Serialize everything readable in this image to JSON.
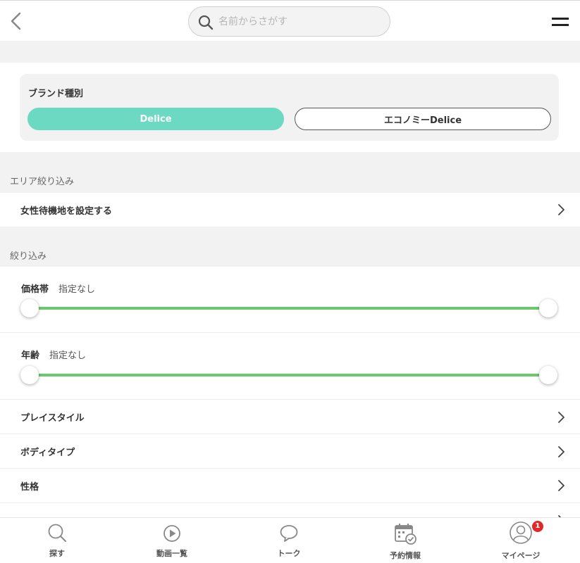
{
  "header": {
    "back_icon": "chevron-left-icon",
    "search_placeholder": "名前からさがす",
    "search_icon": "search-icon",
    "menu_icon": "hamburger-icon"
  },
  "brand": {
    "label": "ブランド種別",
    "options": [
      {
        "label": "Delice",
        "selected": true
      },
      {
        "label": "エコノミーDelice",
        "selected": false
      }
    ],
    "accent_color": "#6cdac2"
  },
  "area": {
    "section_label": "エリア絞り込み",
    "row_label": "女性待機地を設定する"
  },
  "filter": {
    "section_label": "絞り込み",
    "price": {
      "label": "価格帯",
      "value": "指定なし",
      "range": [
        0,
        1
      ]
    },
    "age": {
      "label": "年齢",
      "value": "指定なし",
      "range": [
        0,
        1
      ]
    },
    "slider_color": "#6cc86c",
    "rows": [
      "プレイスタイル",
      "ボディタイプ",
      "性格"
    ]
  },
  "tabbar": {
    "items": [
      {
        "label": "探す",
        "icon": "search-icon"
      },
      {
        "label": "動画一覧",
        "icon": "play-icon"
      },
      {
        "label": "トーク",
        "icon": "speech-bubble-icon"
      },
      {
        "label": "予約情報",
        "icon": "calendar-check-icon"
      },
      {
        "label": "マイページ",
        "icon": "user-icon",
        "badge": "1"
      }
    ],
    "badge_color": "#e02a2a"
  }
}
